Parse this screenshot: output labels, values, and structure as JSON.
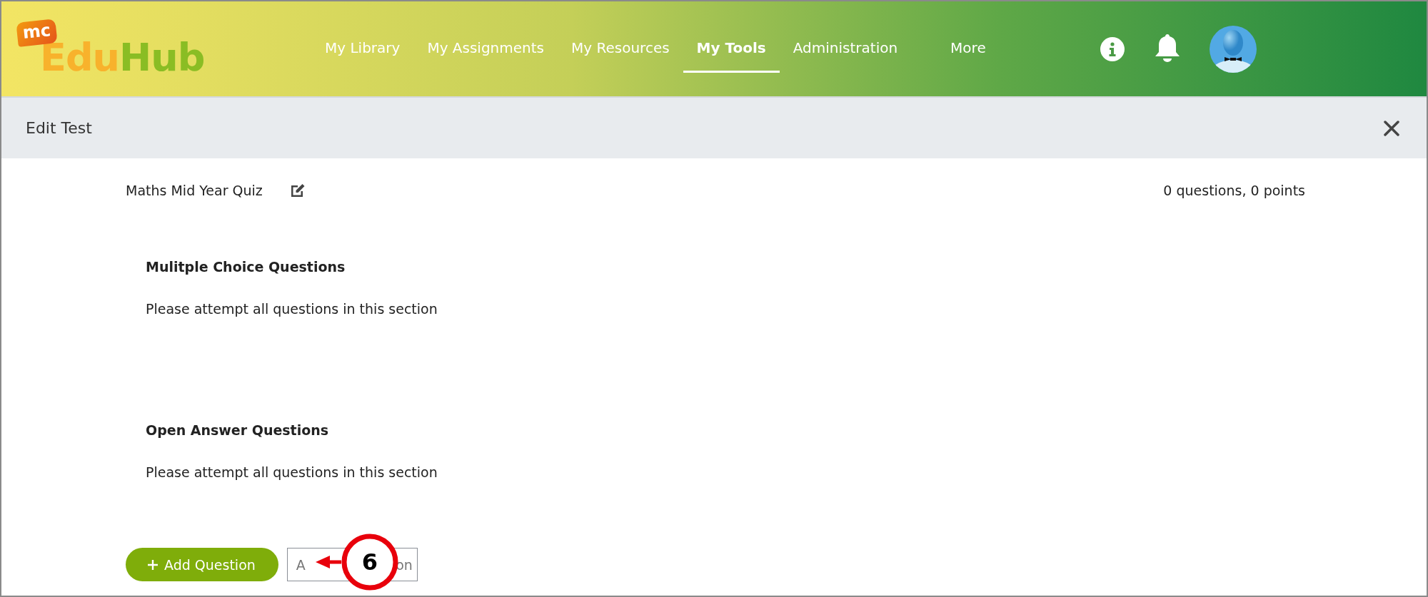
{
  "header": {
    "logo": {
      "prefix": "mc",
      "name_start": "Edu",
      "name_end": "Hub"
    },
    "nav": [
      {
        "label": "My Library",
        "selected": false
      },
      {
        "label": "My Assignments",
        "selected": false
      },
      {
        "label": "My Resources",
        "selected": false
      },
      {
        "label": "My Tools",
        "selected": true
      },
      {
        "label": "Administration",
        "selected": false
      },
      {
        "label": "More",
        "selected": false
      }
    ]
  },
  "panel": {
    "title": "Edit Test"
  },
  "test": {
    "name": "Maths Mid Year Quiz",
    "summary": "0 questions, 0 points",
    "sections": [
      {
        "heading": "Mulitple Choice Questions",
        "instructions": "Please attempt all questions in this section"
      },
      {
        "heading": "Open Answer Questions",
        "instructions": "Please attempt all questions in this section"
      }
    ]
  },
  "buttons": {
    "add_question": "Add Question",
    "second_start": "A",
    "second_end": "on"
  },
  "callout": {
    "number": "6"
  }
}
